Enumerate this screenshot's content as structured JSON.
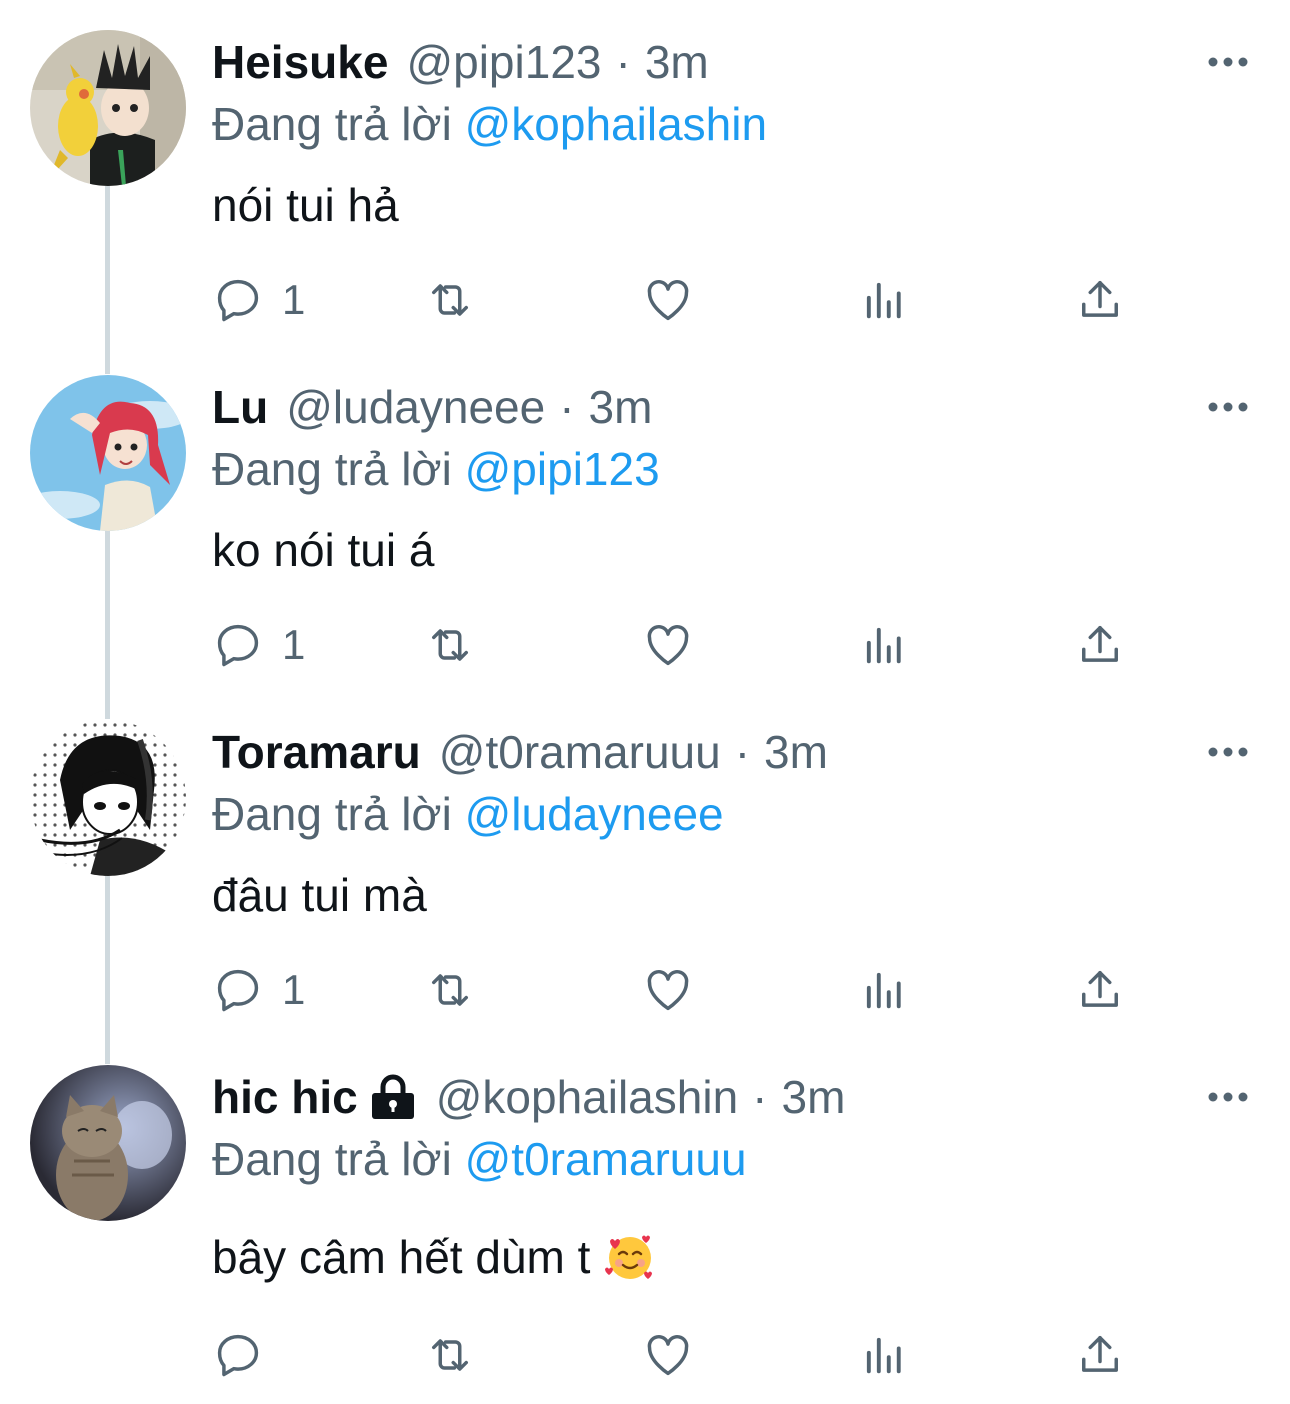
{
  "colors": {
    "text": "#0f1419",
    "secondary": "#536471",
    "accent": "#1d9bf0",
    "thread_line": "#cfd9de"
  },
  "reply_prefix": "Đang trả lời",
  "separator": "·",
  "tweets": [
    {
      "name": "Heisuke",
      "handle": "@pipi123",
      "time": "3m",
      "locked": false,
      "reply_to": "@kophailashin",
      "text": "nói tui hả",
      "reply_count": "1",
      "avatar": "anime-boy-with-parrot-avatar"
    },
    {
      "name": "Lu",
      "handle": "@ludayneee",
      "time": "3m",
      "locked": false,
      "reply_to": "@pipi123",
      "text": "ko nói tui á",
      "reply_count": "1",
      "avatar": "red-haired-girl-avatar"
    },
    {
      "name": "Toramaru",
      "handle": "@t0ramaruuu",
      "time": "3m",
      "locked": false,
      "reply_to": "@ludayneee",
      "text": "đâu tui mà",
      "reply_count": "1",
      "avatar": "manga-girl-avatar"
    },
    {
      "name": "hic hic",
      "handle": "@kophailashin",
      "time": "3m",
      "locked": true,
      "reply_to": "@t0ramaruuu",
      "text": "bây câm hết dùm t",
      "emoji": "smiling-face-with-hearts-emoji",
      "reply_count": "",
      "avatar": "kitten-avatar"
    }
  ]
}
